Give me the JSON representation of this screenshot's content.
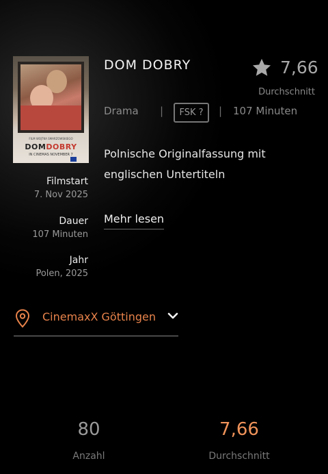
{
  "movie": {
    "title": "DOM DOBRY",
    "poster": {
      "title_part1": "DOM",
      "title_part2": "DOBRY",
      "director_line": "FILM WOJTKA SMARZOWSKIEGO",
      "subtitle": "IN CINEMAS NOVEMBER 7"
    },
    "genre": "Drama",
    "fsk": "FSK ?",
    "duration": "107 Minuten",
    "description": "Polnische Originalfassung mit englischen Untertiteln",
    "read_more_label": "Mehr lesen"
  },
  "rating": {
    "value": "7,66",
    "label": "Durchschnitt",
    "icon": "star-icon"
  },
  "details": {
    "filmstart_label": "Filmstart",
    "filmstart_value": "7. Nov 2025",
    "dauer_label": "Dauer",
    "dauer_value": "107 Minuten",
    "jahr_label": "Jahr",
    "jahr_value": "Polen, 2025"
  },
  "cinema": {
    "name": "CinemaxX Göttingen",
    "icon": "location-pin-icon",
    "accent": "#e8834b"
  },
  "stats": {
    "count_value": "80",
    "count_label": "Anzahl",
    "avg_value": "7,66",
    "avg_label": "Durchschnitt",
    "avg_color": "#f0935a"
  }
}
